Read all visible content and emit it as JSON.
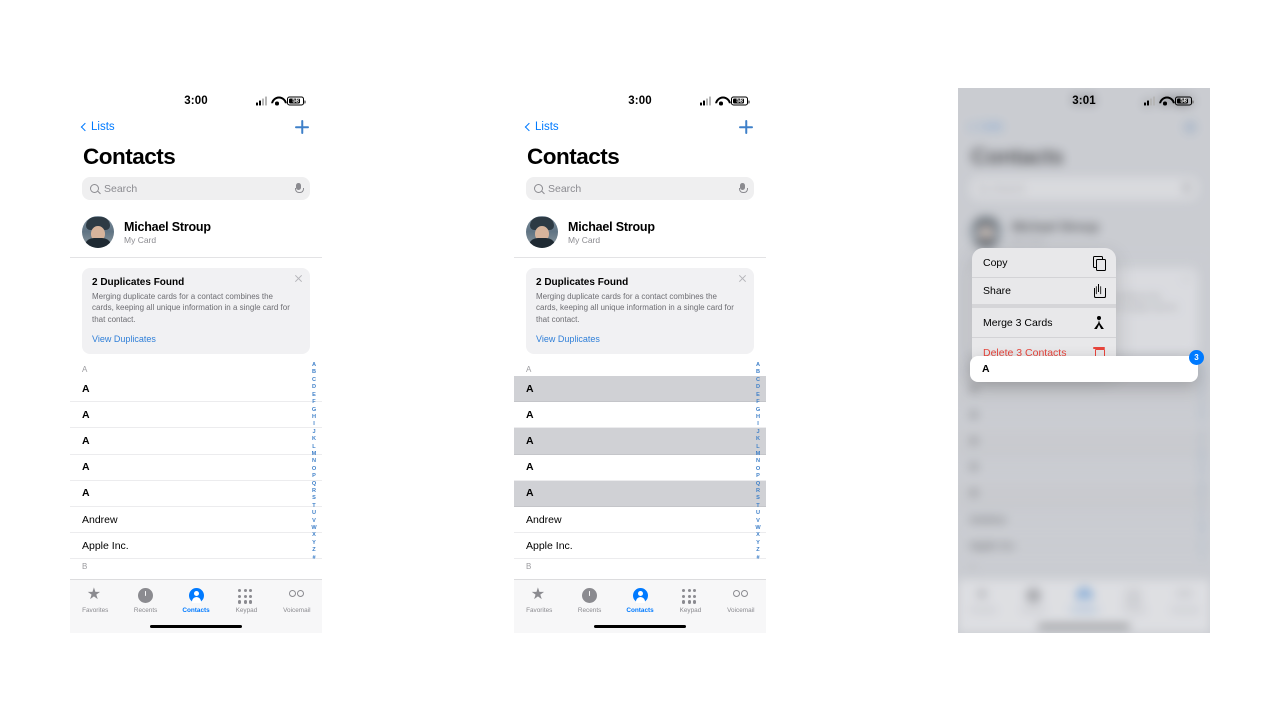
{
  "panels": [
    {
      "id": "panel-1",
      "status": {
        "time": "3:00",
        "battery": "58"
      },
      "nav": {
        "back_label": "Lists",
        "add_label": "+"
      },
      "title": "Contacts",
      "search": {
        "placeholder": "Search"
      },
      "my_card": {
        "name": "Michael Stroup",
        "subtitle": "My Card"
      },
      "duplicates": {
        "title": "2 Duplicates Found",
        "body": "Merging duplicate cards for a contact combines the cards, keeping all unique information in a single card for that contact.",
        "link": "View Duplicates"
      },
      "sections": [
        {
          "header": "A",
          "rows": [
            {
              "label": "A",
              "selected": false
            },
            {
              "label": "A",
              "selected": false
            },
            {
              "label": "A",
              "selected": false
            },
            {
              "label": "A",
              "selected": false
            },
            {
              "label": "A",
              "selected": false
            },
            {
              "label": "Andrew",
              "selected": false
            },
            {
              "label": "Apple Inc.",
              "selected": false
            }
          ]
        },
        {
          "header": "B",
          "rows": []
        }
      ]
    },
    {
      "id": "panel-2",
      "status": {
        "time": "3:00",
        "battery": "58"
      },
      "nav": {
        "back_label": "Lists",
        "add_label": "+"
      },
      "title": "Contacts",
      "search": {
        "placeholder": "Search"
      },
      "my_card": {
        "name": "Michael Stroup",
        "subtitle": "My Card"
      },
      "duplicates": {
        "title": "2 Duplicates Found",
        "body": "Merging duplicate cards for a contact combines the cards, keeping all unique information in a single card for that contact.",
        "link": "View Duplicates"
      },
      "sections": [
        {
          "header": "A",
          "rows": [
            {
              "label": "A",
              "selected": true
            },
            {
              "label": "A",
              "selected": false
            },
            {
              "label": "A",
              "selected": true
            },
            {
              "label": "A",
              "selected": false
            },
            {
              "label": "A",
              "selected": true
            },
            {
              "label": "Andrew",
              "selected": false
            },
            {
              "label": "Apple Inc.",
              "selected": false
            }
          ]
        },
        {
          "header": "B",
          "rows": []
        }
      ]
    }
  ],
  "panel_3": {
    "status": {
      "time": "3:01",
      "battery": "58"
    },
    "context_menu": {
      "items": [
        {
          "label": "Copy",
          "icon": "copy-icon",
          "danger": false
        },
        {
          "label": "Share",
          "icon": "share-icon",
          "danger": false
        },
        {
          "label": "Merge 3 Cards",
          "icon": "merge-person-icon",
          "danger": false
        },
        {
          "label": "Delete 3 Contacts",
          "icon": "trash-icon",
          "danger": true
        }
      ]
    },
    "lifted_card": {
      "label": "A",
      "badge_count": "3"
    }
  },
  "index_letters": [
    "A",
    "B",
    "C",
    "D",
    "E",
    "F",
    "G",
    "H",
    "I",
    "J",
    "K",
    "L",
    "M",
    "N",
    "O",
    "P",
    "Q",
    "R",
    "S",
    "T",
    "U",
    "V",
    "W",
    "X",
    "Y",
    "Z",
    "#"
  ],
  "tabbar": {
    "tabs": [
      {
        "label": "Favorites",
        "icon": "star-icon",
        "active": false
      },
      {
        "label": "Recents",
        "icon": "clock-icon",
        "active": false
      },
      {
        "label": "Contacts",
        "icon": "person-circle-icon",
        "active": true
      },
      {
        "label": "Keypad",
        "icon": "keypad-icon",
        "active": false
      },
      {
        "label": "Voicemail",
        "icon": "voicemail-icon",
        "active": false
      }
    ]
  },
  "colors": {
    "accent": "#007aff",
    "danger": "#e8453c",
    "selected_row": "#d0d1d5"
  }
}
